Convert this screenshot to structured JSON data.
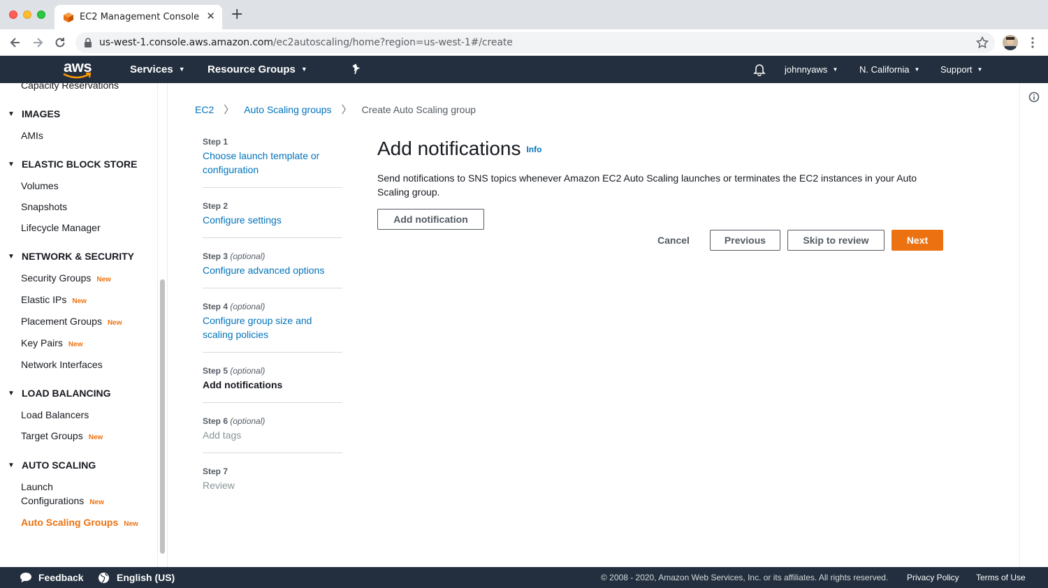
{
  "browser": {
    "tab_title": "EC2 Management Console",
    "url_host": "us-west-1.console.aws.amazon.com",
    "url_path": "/ec2autoscaling/home?region=us-west-1#/create"
  },
  "topnav": {
    "logo_text": "aws",
    "services": "Services",
    "resource_groups": "Resource Groups",
    "user": "johnnyaws",
    "region": "N. California",
    "support": "Support"
  },
  "sidebar": {
    "partial_item": "Capacity Reservations",
    "sections": [
      {
        "title": "IMAGES",
        "items": [
          {
            "label": "AMIs"
          }
        ]
      },
      {
        "title": "ELASTIC BLOCK STORE",
        "items": [
          {
            "label": "Volumes"
          },
          {
            "label": "Snapshots"
          },
          {
            "label": "Lifecycle Manager"
          }
        ]
      },
      {
        "title": "NETWORK & SECURITY",
        "items": [
          {
            "label": "Security Groups",
            "badge": "New"
          },
          {
            "label": "Elastic IPs",
            "badge": "New"
          },
          {
            "label": "Placement Groups",
            "badge": "New"
          },
          {
            "label": "Key Pairs",
            "badge": "New"
          },
          {
            "label": "Network Interfaces"
          }
        ]
      },
      {
        "title": "LOAD BALANCING",
        "items": [
          {
            "label": "Load Balancers"
          },
          {
            "label": "Target Groups",
            "badge": "New"
          }
        ]
      },
      {
        "title": "AUTO SCALING",
        "items": [
          {
            "label_line1": "Launch",
            "label_line2": "Configurations",
            "badge": "New"
          },
          {
            "label": "Auto Scaling Groups",
            "badge": "New"
          }
        ]
      }
    ]
  },
  "breadcrumb": {
    "root": "EC2",
    "parent": "Auto Scaling groups",
    "current": "Create Auto Scaling group"
  },
  "steps": [
    {
      "num": "Step 1",
      "title_line1": "Choose launch template or",
      "title_line2": "configuration"
    },
    {
      "num": "Step 2",
      "title": "Configure settings"
    },
    {
      "num": "Step 3",
      "optional": "(optional)",
      "title": "Configure advanced options"
    },
    {
      "num": "Step 4",
      "optional": "(optional)",
      "title_line1": "Configure group size and",
      "title_line2": "scaling policies"
    },
    {
      "num": "Step 5",
      "optional": "(optional)",
      "title": "Add notifications"
    },
    {
      "num": "Step 6",
      "optional": "(optional)",
      "title": "Add tags"
    },
    {
      "num": "Step 7",
      "title": "Review"
    }
  ],
  "content": {
    "heading": "Add notifications",
    "info": "Info",
    "description": "Send notifications to SNS topics whenever Amazon EC2 Auto Scaling launches or terminates the EC2 instances in your Auto Scaling group.",
    "add_notification": "Add notification",
    "cancel": "Cancel",
    "previous": "Previous",
    "skip": "Skip to review",
    "next": "Next"
  },
  "footer": {
    "feedback": "Feedback",
    "language": "English (US)",
    "copyright": "© 2008 - 2020, Amazon Web Services, Inc. or its affiliates. All rights reserved.",
    "privacy": "Privacy Policy",
    "terms": "Terms of Use"
  },
  "colors": {
    "aws_orange": "#ec7211",
    "link_blue": "#0073bb",
    "nav_dark": "#232f3e"
  }
}
